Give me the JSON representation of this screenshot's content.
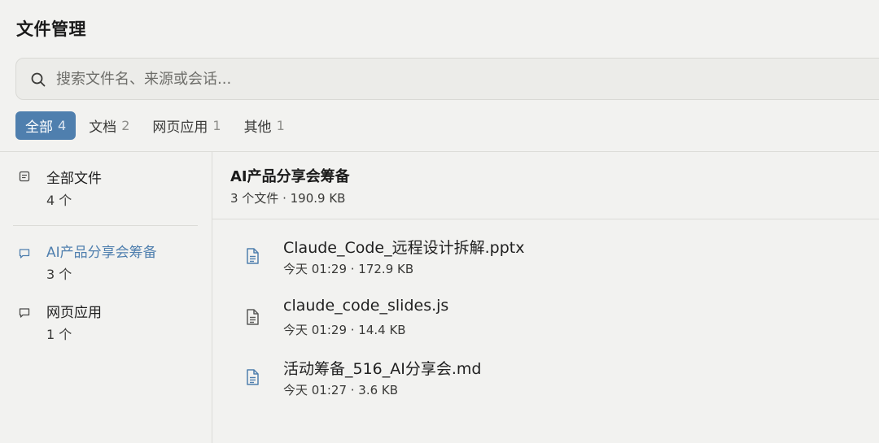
{
  "header": {
    "title": "文件管理"
  },
  "search": {
    "placeholder": "搜索文件名、来源或会话..."
  },
  "tabs": [
    {
      "label": "全部",
      "count": "4",
      "active": true
    },
    {
      "label": "文档",
      "count": "2",
      "active": false
    },
    {
      "label": "网页应用",
      "count": "1",
      "active": false
    },
    {
      "label": "其他",
      "count": "1",
      "active": false
    }
  ],
  "sidebar": {
    "groups": [
      {
        "name": "全部文件",
        "count": "4 个",
        "icon": "document-list-icon",
        "active": false
      },
      {
        "name": "AI产品分享会筹备",
        "count": "3 个",
        "icon": "chat-bubble-icon",
        "active": true
      },
      {
        "name": "网页应用",
        "count": "1 个",
        "icon": "chat-bubble-icon",
        "active": false
      }
    ]
  },
  "detail": {
    "title": "AI产品分享会筹备",
    "meta": "3 个文件 · 190.9 KB",
    "files": [
      {
        "name": "Claude_Code_远程设计拆解.pptx",
        "meta": "今天 01:29 · 172.9 KB",
        "icon": "document-icon",
        "icon_color": "#4f7fae"
      },
      {
        "name": "claude_code_slides.js",
        "meta": "今天 01:29 · 14.4 KB",
        "icon": "document-icon",
        "icon_color": "#5a5a58"
      },
      {
        "name": "活动筹备_516_AI分享会.md",
        "meta": "今天 01:27 · 3.6 KB",
        "icon": "document-icon",
        "icon_color": "#4f7fae"
      }
    ]
  },
  "colors": {
    "accent": "#4f7fae",
    "background": "#f2f2f0",
    "divider": "#dcdcd8"
  }
}
